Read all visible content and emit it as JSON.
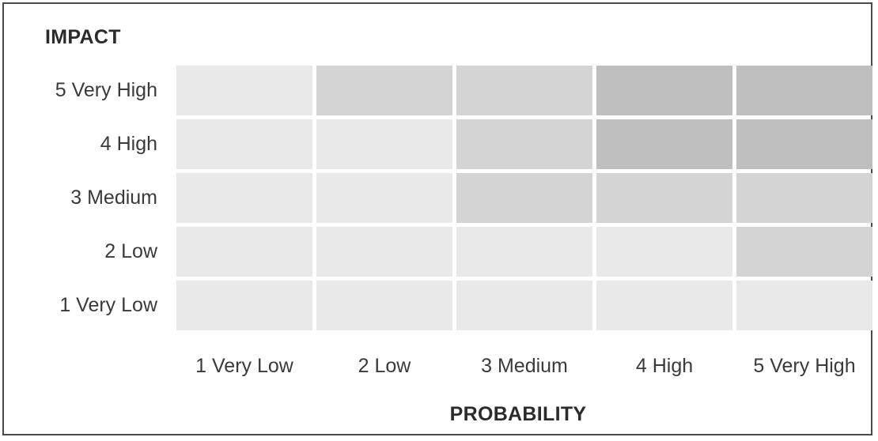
{
  "axes": {
    "y_title": "IMPACT",
    "x_title": "PROBABILITY"
  },
  "chart_data": {
    "type": "heatmap",
    "title": "",
    "xlabel": "PROBABILITY",
    "ylabel": "IMPACT",
    "grid": false,
    "legend": "none",
    "x_categories": [
      "1 Very Low",
      "2 Low",
      "3 Medium",
      "4 High",
      "5 Very High"
    ],
    "y_categories": [
      "1 Very Low",
      "2 Low",
      "3 Medium",
      "4 High",
      "5 Very High"
    ],
    "y_categories_top_to_bottom": [
      "5 Very High",
      "4 High",
      "3 Medium",
      "2 Low",
      "1 Very Low"
    ],
    "value_scale": {
      "1": "light",
      "2": "medium",
      "3": "dark"
    },
    "colors": {
      "light": "#e9e9e9",
      "medium": "#d4d4d4",
      "dark": "#bfbfbf",
      "border": "#4a4a4a",
      "text": "#3a3a3a",
      "title_text": "#2b2b2b",
      "background": "#ffffff"
    },
    "rows_top_to_bottom": [
      {
        "impact": "5 Very High",
        "values": [
          1,
          2,
          2,
          3,
          3
        ]
      },
      {
        "impact": "4 High",
        "values": [
          1,
          1,
          2,
          3,
          3
        ]
      },
      {
        "impact": "3 Medium",
        "values": [
          1,
          1,
          2,
          2,
          2
        ]
      },
      {
        "impact": "2 Low",
        "values": [
          1,
          1,
          1,
          1,
          2
        ]
      },
      {
        "impact": "1 Very Low",
        "values": [
          1,
          1,
          1,
          1,
          1
        ]
      }
    ]
  }
}
